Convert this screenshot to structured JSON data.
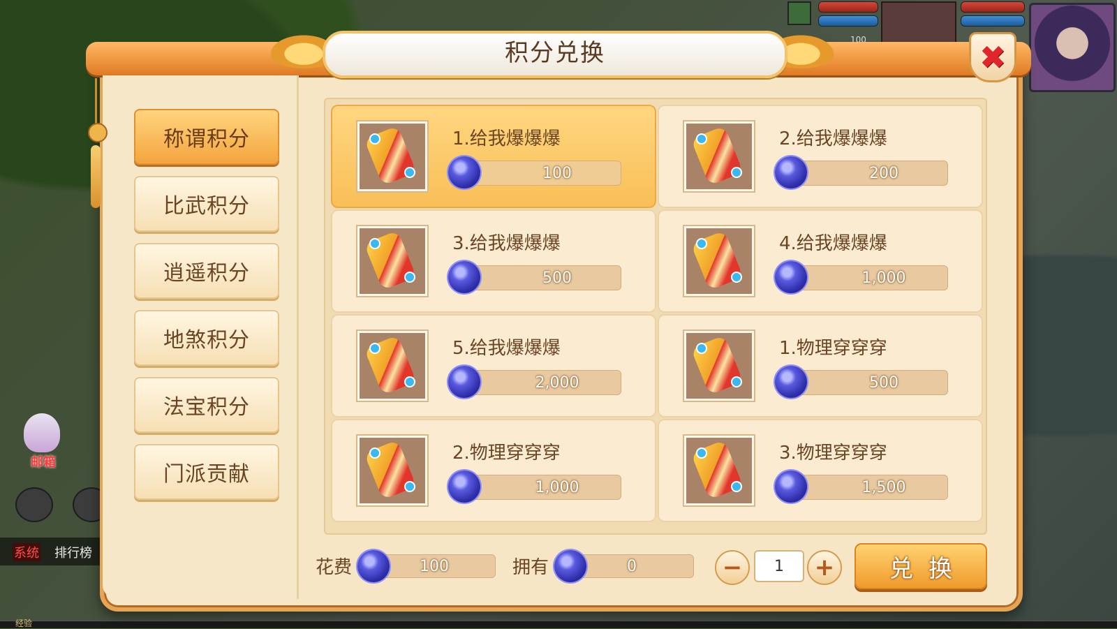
{
  "dialog": {
    "title": "积分兑换",
    "close_symbol": "✖"
  },
  "tabs": [
    {
      "label": "称谓积分",
      "active": true
    },
    {
      "label": "比武积分",
      "active": false
    },
    {
      "label": "逍遥积分",
      "active": false
    },
    {
      "label": "地煞积分",
      "active": false
    },
    {
      "label": "法宝积分",
      "active": false
    },
    {
      "label": "门派贡献",
      "active": false
    }
  ],
  "items": [
    {
      "name": "1.给我爆爆爆",
      "price": "100",
      "selected": true,
      "icon": "title-scroll-icon"
    },
    {
      "name": "2.给我爆爆爆",
      "price": "200",
      "selected": false,
      "icon": "title-scroll-icon"
    },
    {
      "name": "3.给我爆爆爆",
      "price": "500",
      "selected": false,
      "icon": "title-scroll-icon"
    },
    {
      "name": "4.给我爆爆爆",
      "price": "1,000",
      "selected": false,
      "icon": "title-scroll-icon"
    },
    {
      "name": "5.给我爆爆爆",
      "price": "2,000",
      "selected": false,
      "icon": "title-scroll-icon"
    },
    {
      "name": "1.物理穿穿穿",
      "price": "500",
      "selected": false,
      "icon": "title-scroll-icon"
    },
    {
      "name": "2.物理穿穿穿",
      "price": "1,000",
      "selected": false,
      "icon": "title-scroll-icon"
    },
    {
      "name": "3.物理穿穿穿",
      "price": "1,500",
      "selected": false,
      "icon": "title-scroll-icon"
    }
  ],
  "footer": {
    "cost_label": "花费",
    "cost_value": "100",
    "owned_label": "拥有",
    "owned_value": "0",
    "minus_symbol": "−",
    "plus_symbol": "+",
    "quantity": "1",
    "exchange_label": "兑换"
  },
  "hud": {
    "pet_level": "100",
    "mailbox_label": "邮箱",
    "chat_channel": "系统",
    "chat_text": "排行榜",
    "xp_label": "经验"
  },
  "colors": {
    "accent_orange": "#f4a53e",
    "close_red": "#e0262a",
    "panel_bg": "#f7e6c6",
    "currency_purple": "#5a5ae0"
  }
}
